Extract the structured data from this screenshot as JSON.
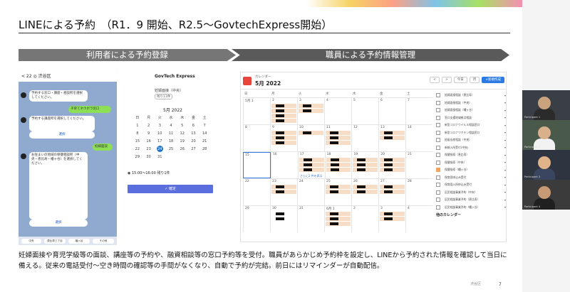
{
  "slide": {
    "title": "LINEによる予約　（R1．9 開始、R2.5～GovtechExpress開始）",
    "banner_left": "利用者による予約登録",
    "banner_right": "職員による予約情報管理",
    "description": "妊婦面接や育児学級等の面談、講座等の予約や、融資相談等の窓口予約等を受付。職員があらかじめ予約枠を設定し、LINEから予約された情報を確認して当日に備える。従来の電話受付～空き時間の確認等の手間がなくなり、自動で予約が完結。前日にはリマインダーが自動配信。",
    "page_number": "7",
    "footer_logo": "渋谷区"
  },
  "phone": {
    "header": "< 22  ◎ 渋谷区",
    "bubbles": [
      "予約する窓口・講座・相談所を選択してください。",
      "子育てネウボラ窓口",
      "予約する講座所を選択してください。",
      "選択",
      "妊婦面談",
      "お住まいの地域の保健相談所（中央・恵比寿・幡ヶ谷）を選択してください。",
      "選択"
    ],
    "footer_pills": [
      "中央",
      "恵比寿三丁目",
      "幡ヶ谷",
      "その他"
    ]
  },
  "gov": {
    "title": "GovTech Express",
    "office": "妊娠面接（中央）",
    "tag": "残り11件",
    "month": "5月 2022",
    "weekdays": [
      "日",
      "月",
      "火",
      "水",
      "木",
      "金",
      "土"
    ],
    "weeks": [
      [
        "1",
        "2",
        "3",
        "4",
        "5",
        "6",
        "7"
      ],
      [
        "8",
        "9",
        "10",
        "11",
        "12",
        "13",
        "14"
      ],
      [
        "15",
        "16",
        "17",
        "18",
        "19",
        "20",
        "21"
      ],
      [
        "22",
        "23",
        "24",
        "25",
        "26",
        "27",
        "28"
      ],
      [
        "29",
        "30",
        "31",
        "",
        "",
        "",
        ""
      ]
    ],
    "selected_day": "24",
    "slot": "◉ 15:00～16:00  残り1件",
    "confirm": "✓ 確定"
  },
  "staff": {
    "app_name": "カレンダー",
    "month": "5月 2022",
    "buttons": [
      "<",
      ">",
      "今日",
      "月",
      "+新規作成"
    ],
    "weekdays": [
      "日",
      "月",
      "火",
      "水",
      "木",
      "金",
      "土"
    ],
    "weeks": [
      [
        "5月 1",
        "2",
        "3",
        "4",
        "5",
        "6",
        "7"
      ],
      [
        "8",
        "9",
        "10",
        "11",
        "12",
        "13",
        "14"
      ],
      [
        "15",
        "16",
        "17",
        "18",
        "19",
        "20",
        "21"
      ],
      [
        "22",
        "23",
        "24",
        "25",
        "26",
        "27",
        "28"
      ],
      [
        "29",
        "30",
        "31",
        "6月 1",
        "2",
        "3",
        "4"
      ]
    ],
    "more_link": "さらに2 件を表示",
    "sidebar": [
      "妊婦面接相談（恵比寿）",
      "妊婦面接相談（中央）",
      "妊婦面接相談（幡ヶ谷）",
      "窓口支援地域拠点相談",
      "新型コロナウイルス相談窓口",
      "新型コロナワクチン相談窓口",
      "妊娠出産相談（中央）",
      "新規入所受付(中央)",
      "保健指導（恵比寿）",
      "保健指導（中央）",
      "保健指導（幡ヶ谷）",
      "保育園申込み受付",
      "保育園入所申込み受付",
      "区民相談事業予約（中央）",
      "区民相談事業予約（恵比寿）",
      "区民相談事業予約（幡ヶ谷）"
    ],
    "sidebar_footer": "他のカレンダー"
  },
  "videos": [
    {
      "name": "Participant 1",
      "bg": "#3a3f46",
      "skin": "#c9a27e",
      "shirt": "#2b2b2b"
    },
    {
      "name": "Participant 2",
      "bg": "#4a5a4a",
      "skin": "#d9b08c",
      "shirt": "#f2f2f2"
    },
    {
      "name": "Participant 3",
      "bg": "#2e3440",
      "skin": "#e0b48a",
      "shirt": "#3a4660"
    },
    {
      "name": "Participant 4",
      "bg": "#3b3b3b",
      "skin": "#c69a74",
      "shirt": "#202020"
    }
  ]
}
